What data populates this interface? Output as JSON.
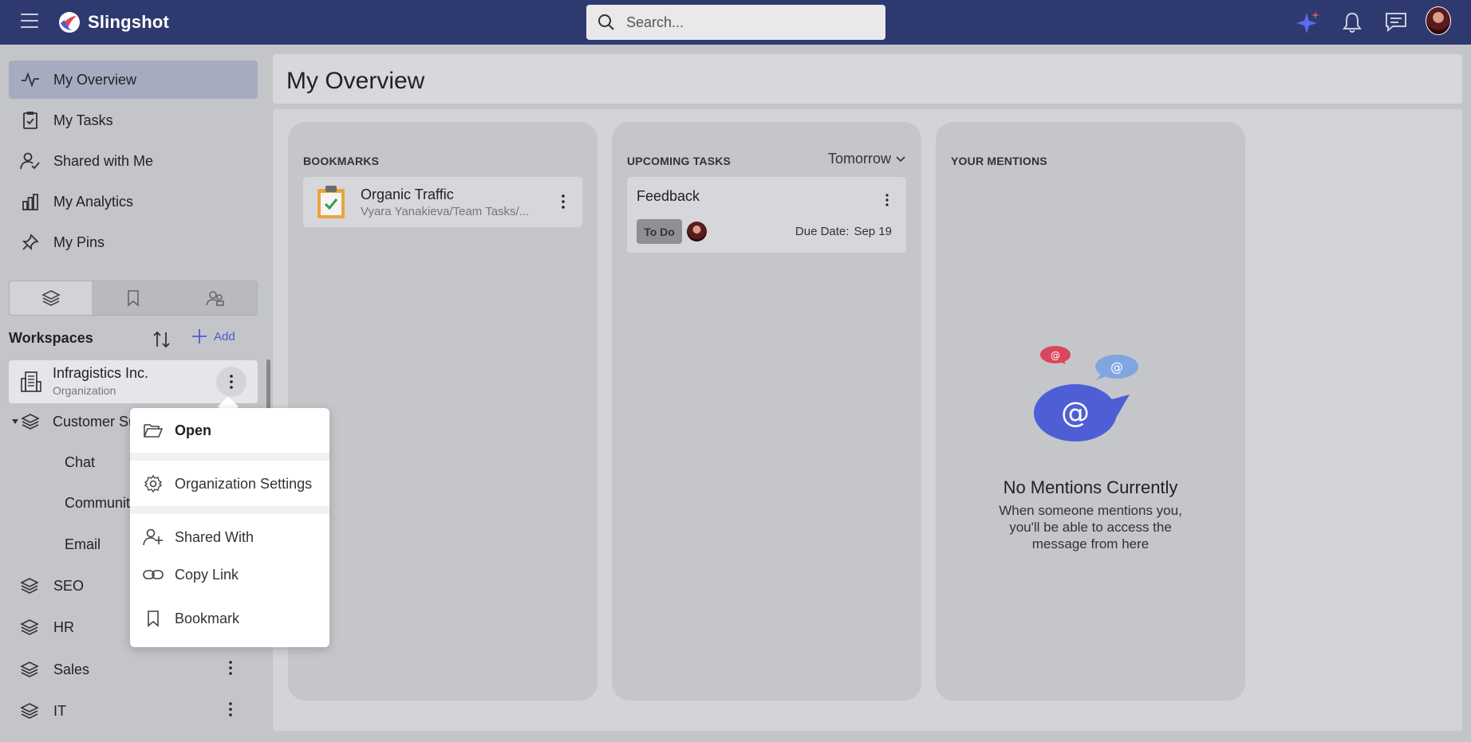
{
  "app": {
    "name": "Slingshot"
  },
  "search": {
    "placeholder": "Search..."
  },
  "nav": {
    "items": [
      {
        "label": "My Overview"
      },
      {
        "label": "My Tasks"
      },
      {
        "label": "Shared with Me"
      },
      {
        "label": "My Analytics"
      },
      {
        "label": "My Pins"
      }
    ]
  },
  "workspaces": {
    "title": "Workspaces",
    "add_label": "Add",
    "org": {
      "name": "Infragistics Inc.",
      "sub": "Organization"
    },
    "customer": {
      "label": "Customer Su"
    },
    "children": [
      "Chat",
      "Communit",
      "Email"
    ],
    "rows": [
      "SEO",
      "HR",
      "Sales",
      "IT"
    ]
  },
  "context_menu": {
    "items": [
      "Open",
      "Organization Settings",
      "Shared With",
      "Copy Link",
      "Bookmark"
    ]
  },
  "page": {
    "title": "My Overview"
  },
  "bookmarks": {
    "title": "BOOKMARKS",
    "item": {
      "name": "Organic Traffic",
      "path": "Vyara Yanakieva/Team Tasks/..."
    }
  },
  "tasks": {
    "title": "UPCOMING TASKS",
    "filter": "Tomorrow",
    "item": {
      "name": "Feedback",
      "status": "To Do",
      "due_label": "Due Date:",
      "due_value": "Sep 19"
    }
  },
  "mentions": {
    "title": "YOUR MENTIONS",
    "empty_title": "No Mentions Currently",
    "empty_text": "When someone mentions you, you'll be able to access the message from here"
  },
  "colors": {
    "topbar": "#2e3a6f",
    "accent": "#4a5bd1",
    "mention_main": "#4e5fd6",
    "mention_red": "#d9475d",
    "mention_light": "#7fa6e0"
  }
}
